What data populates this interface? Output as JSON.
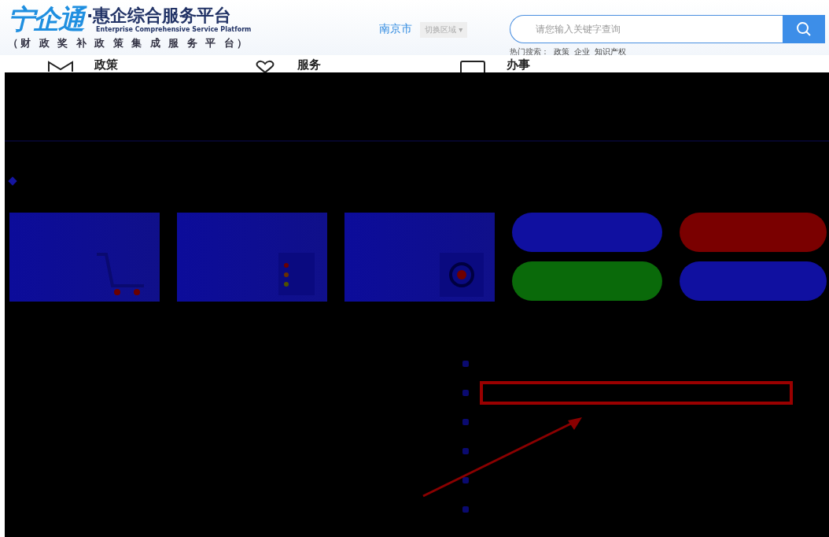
{
  "header": {
    "logo": "宁企通",
    "title": "·惠企综合服务平台",
    "subtitle_en": "Enterprise Comprehensive Service Platform",
    "subtitle_cn": "（财 政 奖 补 政 策 集 成 服 务 平 台）",
    "city": "南京市",
    "region_dropdown": "切换区域",
    "region_caret": "▾"
  },
  "search": {
    "placeholder": "请您输入关键字查询",
    "hot_label": "热门搜索：",
    "hot_terms": [
      "政策",
      "企业",
      "知识产权"
    ]
  },
  "nav": [
    {
      "kind": "mail",
      "title": "政策"
    },
    {
      "kind": "heart",
      "title": "服务"
    },
    {
      "kind": "monitor",
      "title": "办事"
    }
  ],
  "cards": [
    {
      "kind": "cart"
    },
    {
      "kind": "list"
    },
    {
      "kind": "target"
    }
  ],
  "pills": [
    {
      "color": "#1010a0"
    },
    {
      "color": "#7a0000"
    },
    {
      "color": "#0a6a0a"
    },
    {
      "color": "#1010a0"
    }
  ],
  "list": {
    "rows": [
      {
        "selected": false
      },
      {
        "selected": true
      },
      {
        "selected": false
      },
      {
        "selected": false
      },
      {
        "selected": false
      },
      {
        "selected": false
      }
    ]
  }
}
